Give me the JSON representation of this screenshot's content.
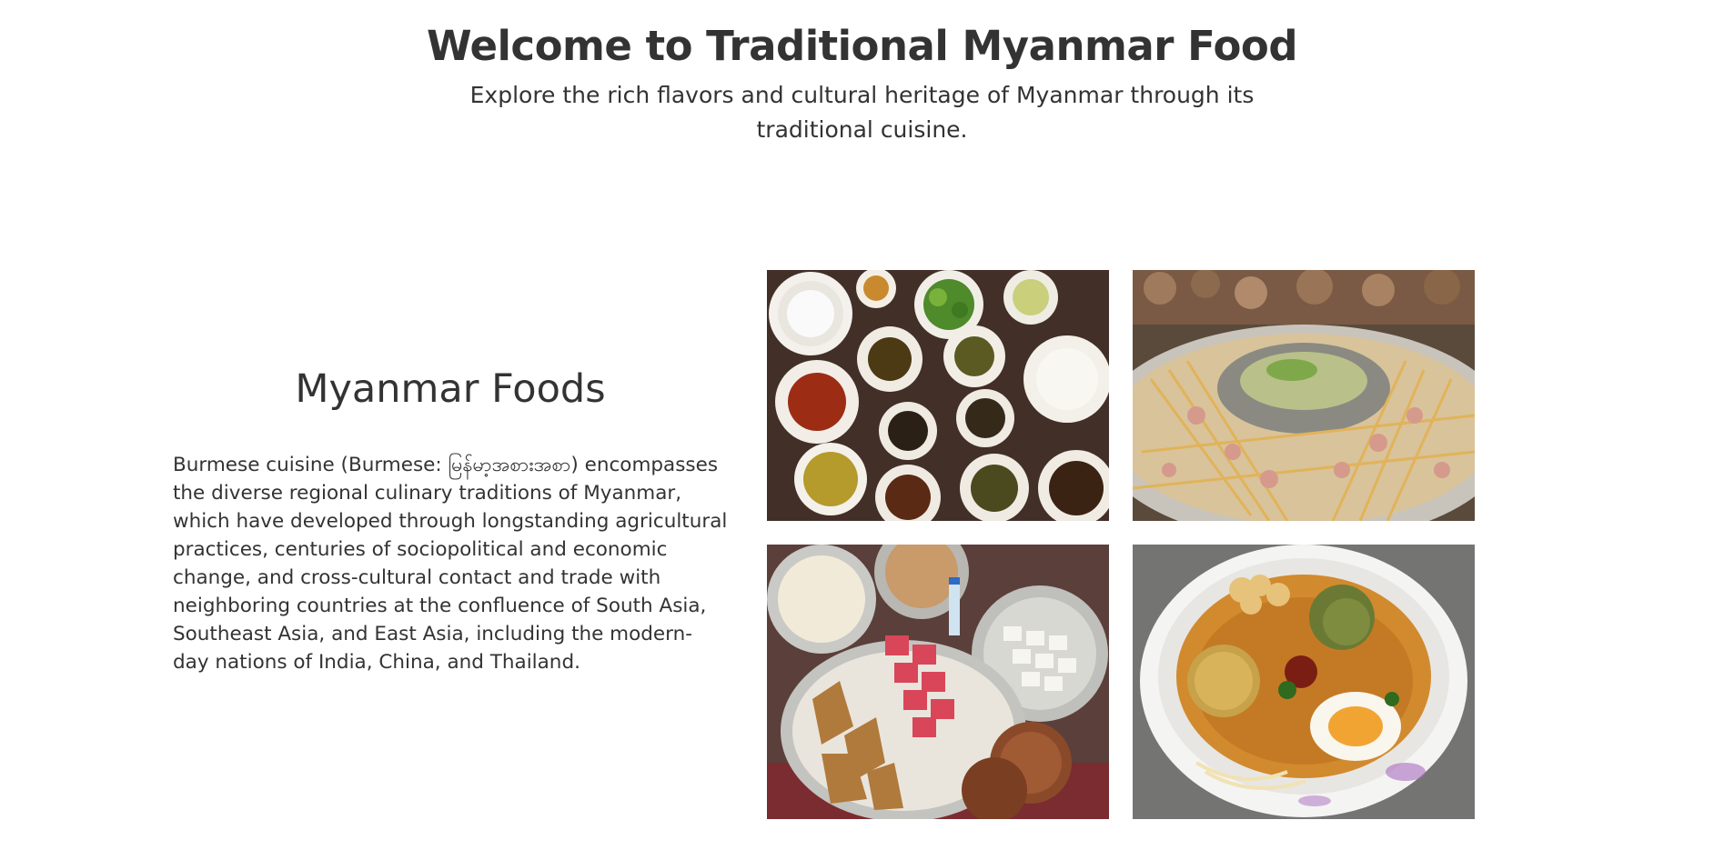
{
  "hero": {
    "title": "Welcome to Traditional Myanmar Food",
    "subtitle": "Explore the rich flavors and cultural heritage of Myanmar through its traditional cuisine."
  },
  "section": {
    "heading": "Myanmar Foods",
    "body": "Burmese cuisine (Burmese: မြန်မာ့အစားအစာ) encompasses the diverse regional culinary traditions of Myanmar, which have developed through longstanding agricultural practices, centuries of sociopolitical and economic change, and cross-cultural contact and trade with neighboring countries at the confluence of South Asia, Southeast Asia, and East Asia, including the modern-day nations of India, China, and Thailand."
  },
  "gallery": {
    "images": [
      {
        "subject": "rice-and-curry-spread-photo"
      },
      {
        "subject": "hot-pot-skewers-photo"
      },
      {
        "subject": "market-snacks-platter-photo"
      },
      {
        "subject": "noodle-soup-bowl-photo"
      }
    ]
  }
}
